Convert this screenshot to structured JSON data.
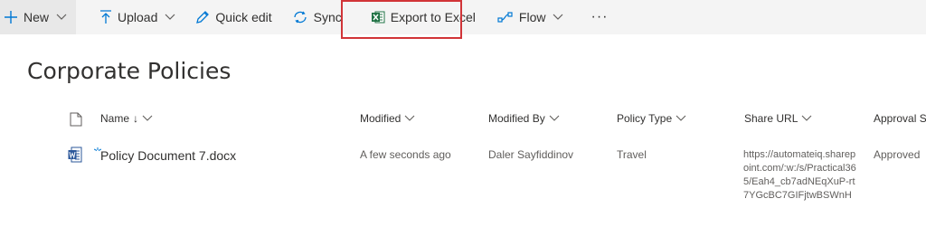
{
  "toolbar": {
    "new_label": "New",
    "upload_label": "Upload",
    "quick_edit_label": "Quick edit",
    "sync_label": "Sync",
    "export_label": "Export to Excel",
    "flow_label": "Flow",
    "more_label": "···",
    "highlight_color": "#d13438",
    "excel_color": "#217346"
  },
  "page": {
    "title": "Corporate Policies"
  },
  "columns": {
    "name": "Name",
    "sort_arrow": "↓",
    "modified": "Modified",
    "modified_by": "Modified By",
    "policy_type": "Policy Type",
    "share_url": "Share URL",
    "approval": "Approval St"
  },
  "rows": [
    {
      "name": "Policy Document 7.docx",
      "modified": "A few seconds ago",
      "modified_by": "Daler Sayfiddinov",
      "policy_type": "Travel",
      "share_url": "https://automateiq.sharepoint.com/:w:/s/Practical365/Eah4_cb7adNEqXuP-rt7YGcBC7GIFjtwBSWnH",
      "approval": "Approved"
    }
  ]
}
